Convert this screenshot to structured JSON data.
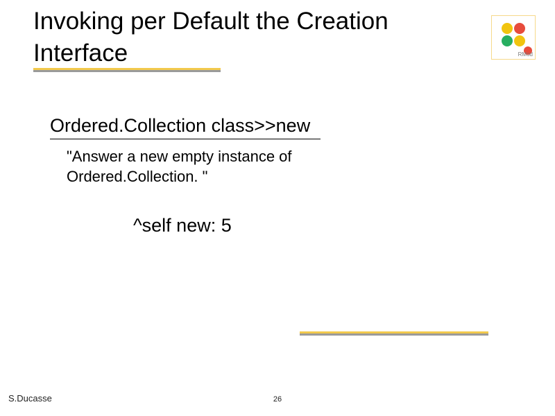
{
  "title": "Invoking per Default the Creation Interface",
  "logo_label": "RMod",
  "method_signature": "Ordered.Collection class>>new",
  "comment": "\"Answer a new empty instance of Ordered.Collection. \"",
  "code": "^self new: 5",
  "footer_author": "S.Ducasse",
  "footer_page": "26"
}
